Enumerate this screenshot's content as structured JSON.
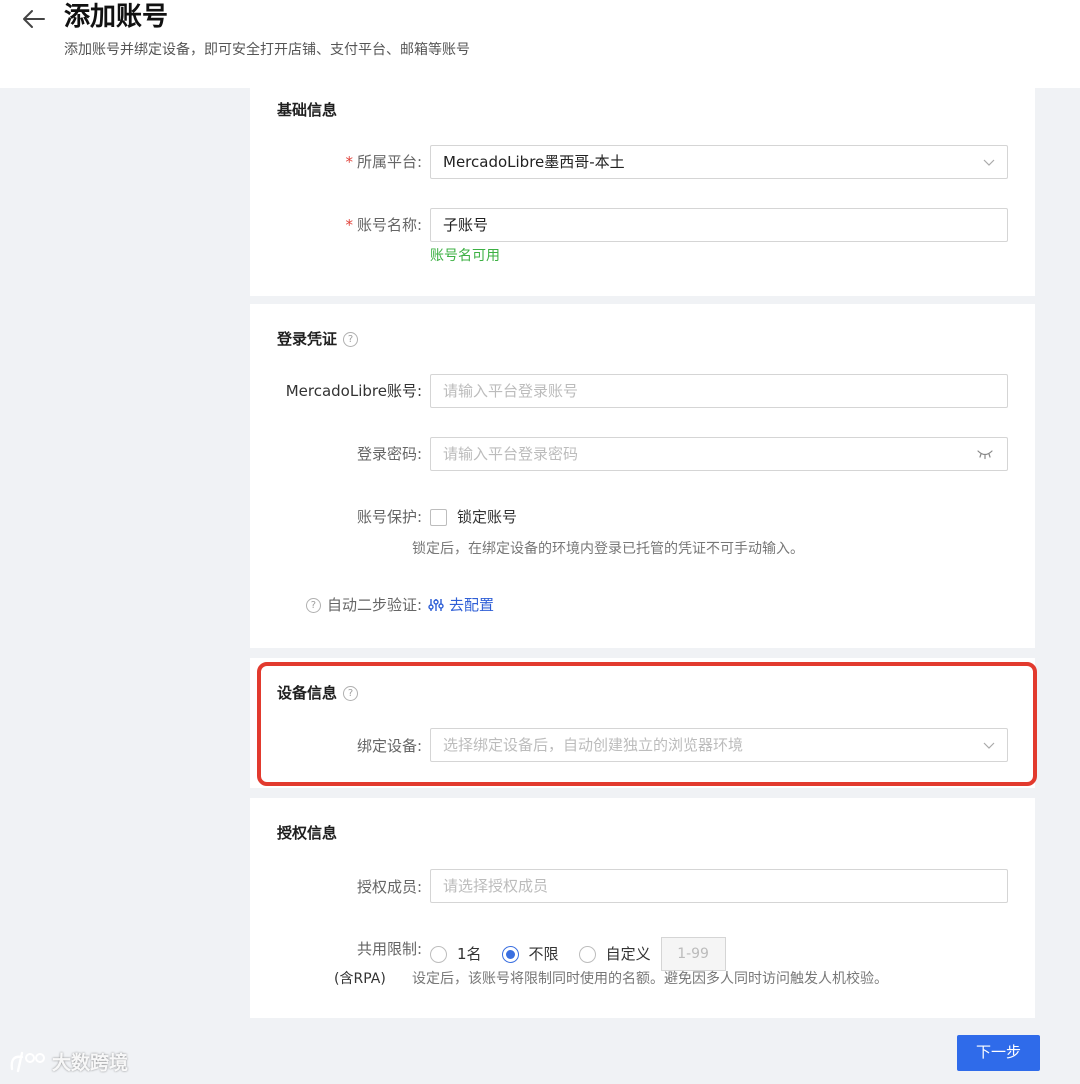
{
  "header": {
    "title": "添加账号",
    "subtitle": "添加账号并绑定设备，即可安全打开店铺、支付平台、邮箱等账号"
  },
  "basic_info": {
    "title": "基础信息",
    "platform_label": "所属平台:",
    "platform_value": "MercadoLibre墨西哥-本土",
    "account_name_label": "账号名称:",
    "account_name_value": "子账号",
    "account_name_hint": "账号名可用"
  },
  "login_credentials": {
    "title": "登录凭证",
    "account_label": "MercadoLibre账号:",
    "account_placeholder": "请输入平台登录账号",
    "password_label": "登录密码:",
    "password_placeholder": "请输入平台登录密码",
    "protection_label": "账号保护:",
    "lock_checkbox_label": "锁定账号",
    "lock_note": "锁定后，在绑定设备的环境内登录已托管的凭证不可手动输入。",
    "two_step_label": "自动二步验证:",
    "config_link": "去配置"
  },
  "device_info": {
    "title": "设备信息",
    "bind_label": "绑定设备:",
    "bind_placeholder": "选择绑定设备后，自动创建独立的浏览器环境"
  },
  "authorization": {
    "title": "授权信息",
    "members_label": "授权成员:",
    "members_placeholder": "请选择授权成员",
    "share_label": "共用限制:",
    "options": [
      "1名",
      "不限",
      "自定义"
    ],
    "selected_option": "不限",
    "custom_placeholder": "1-99",
    "rpa_label": "(含RPA)",
    "limit_note": "设定后，该账号将限制同时使用的名额。避免因多人同时访问触发人机校验。"
  },
  "footer": {
    "next_label": "下一步"
  },
  "watermark": {
    "text": "大数跨境"
  },
  "colors": {
    "primary": "#2f6bea",
    "required": "#e0443c",
    "success": "#3cb043",
    "highlight": "#e23a2e"
  }
}
